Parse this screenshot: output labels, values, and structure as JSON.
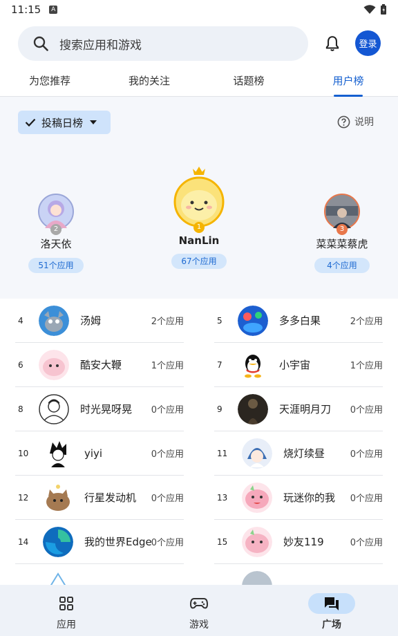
{
  "status": {
    "time": "11:15",
    "a_badge": "A"
  },
  "search": {
    "placeholder": "搜索应用和游戏"
  },
  "header": {
    "login_label": "登录"
  },
  "tabs": [
    "为您推荐",
    "我的关注",
    "话题榜",
    "用户榜"
  ],
  "filter": {
    "label": "投稿日榜",
    "help_label": "说明"
  },
  "podium": [
    {
      "rank": "2",
      "name": "洛天依",
      "count": "51个应用"
    },
    {
      "rank": "1",
      "name": "NanLin",
      "count": "67个应用"
    },
    {
      "rank": "3",
      "name": "菜菜菜蔡虎",
      "count": "4个应用"
    }
  ],
  "ranking": [
    {
      "rank": "4",
      "name": "汤姆",
      "count": "2个应用"
    },
    {
      "rank": "5",
      "name": "多多白果",
      "count": "2个应用"
    },
    {
      "rank": "6",
      "name": "酷安大鞭",
      "count": "1个应用"
    },
    {
      "rank": "7",
      "name": "小宇宙",
      "count": "1个应用"
    },
    {
      "rank": "8",
      "name": "时光晃呀晃",
      "count": "0个应用"
    },
    {
      "rank": "9",
      "name": "天涯明月刀",
      "count": "0个应用"
    },
    {
      "rank": "10",
      "name": "yiyi",
      "count": "0个应用"
    },
    {
      "rank": "11",
      "name": "烧灯续昼",
      "count": "0个应用"
    },
    {
      "rank": "12",
      "name": "行星发动机",
      "count": "0个应用"
    },
    {
      "rank": "13",
      "name": "玩迷你的我",
      "count": "0个应用"
    },
    {
      "rank": "14",
      "name": "我的世界Edge",
      "count": "0个应用"
    },
    {
      "rank": "15",
      "name": "妙友119",
      "count": "0个应用"
    }
  ],
  "nav": [
    {
      "label": "应用",
      "icon": "grid-icon"
    },
    {
      "label": "游戏",
      "icon": "gamepad-icon"
    },
    {
      "label": "广场",
      "icon": "chat-icon"
    }
  ],
  "colors": {
    "accent": "#1560d0",
    "chip_bg": "#d3e6fb",
    "gold": "#f5b400",
    "silver": "#a8a8a8",
    "bronze": "#e8774b"
  }
}
